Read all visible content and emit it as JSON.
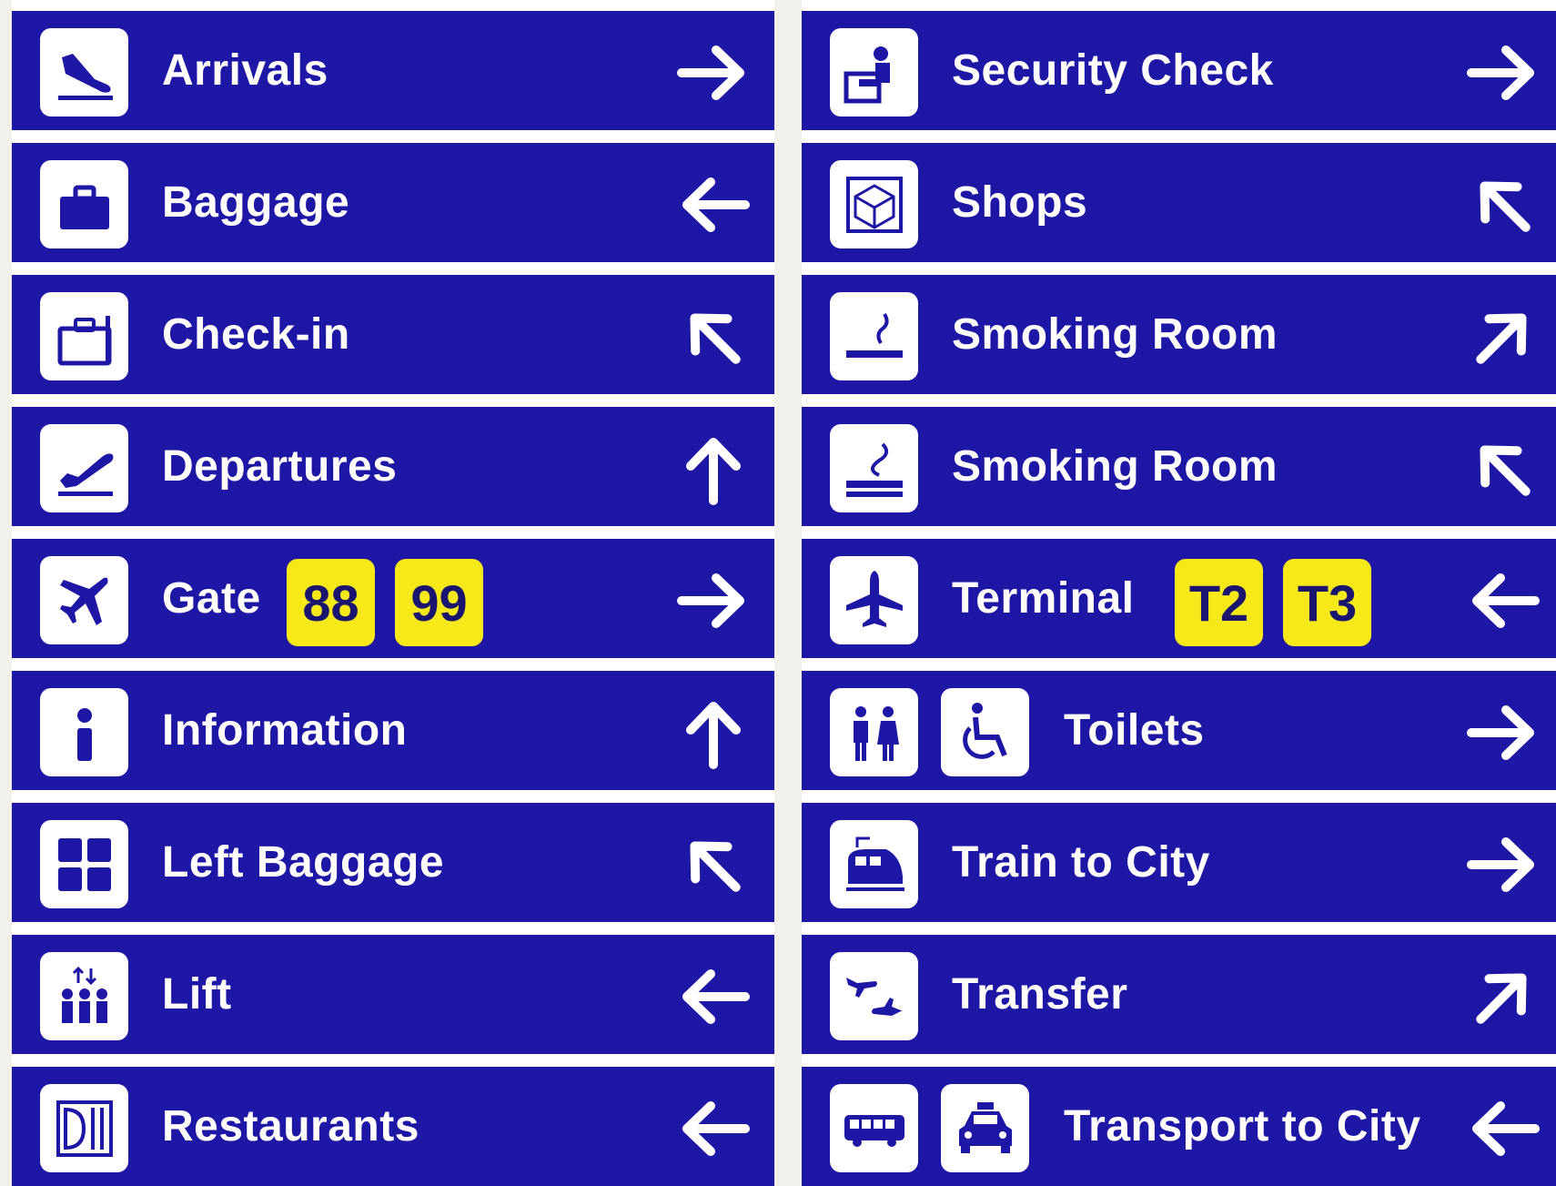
{
  "colors": {
    "sign_blue": "#1e17a5",
    "badge_yellow": "#f7e81a",
    "badge_text": "#1a1670",
    "icon_bg": "#ffffff"
  },
  "left_signs": [
    {
      "label": "Arrivals",
      "icon": "arrivals-plane-icon",
      "arrow": "right"
    },
    {
      "label": "Baggage",
      "icon": "suitcase-icon",
      "arrow": "left"
    },
    {
      "label": "Check-in",
      "icon": "check-in-counter-icon",
      "arrow": "up-left"
    },
    {
      "label": "Departures",
      "icon": "departures-plane-icon",
      "arrow": "up"
    },
    {
      "label": "Gate",
      "icon": "airplane-icon",
      "arrow": "right",
      "badges": [
        "88",
        "99"
      ]
    },
    {
      "label": "Information",
      "icon": "information-icon",
      "arrow": "up"
    },
    {
      "label": "Left Baggage",
      "icon": "lockers-icon",
      "arrow": "up-left"
    },
    {
      "label": "Lift",
      "icon": "lift-icon",
      "arrow": "left"
    },
    {
      "label": "Restaurants",
      "icon": "restaurant-cutlery-icon",
      "arrow": "left"
    }
  ],
  "right_signs": [
    {
      "label": "Security Check",
      "icon": "security-officer-icon",
      "arrow": "right"
    },
    {
      "label": "Shops",
      "icon": "gift-box-icon",
      "arrow": "up-left"
    },
    {
      "label": "Smoking Room",
      "icon": "cigarette-icon",
      "arrow": "up-right"
    },
    {
      "label": "Smoking Room",
      "icon": "smoking-ashtray-icon",
      "arrow": "up-left"
    },
    {
      "label": "Terminal",
      "icon": "airplane-up-icon",
      "arrow": "left",
      "badges": [
        "T2",
        "T3"
      ]
    },
    {
      "label": "Toilets",
      "icon": "toilets-icon",
      "icon2": "wheelchair-icon",
      "arrow": "right"
    },
    {
      "label": "Train to City",
      "icon": "train-icon",
      "arrow": "right"
    },
    {
      "label": "Transfer",
      "icon": "transfer-planes-icon",
      "arrow": "up-right"
    },
    {
      "label": "Transport to City",
      "icon": "bus-icon",
      "icon2": "taxi-icon",
      "arrow": "left"
    }
  ]
}
